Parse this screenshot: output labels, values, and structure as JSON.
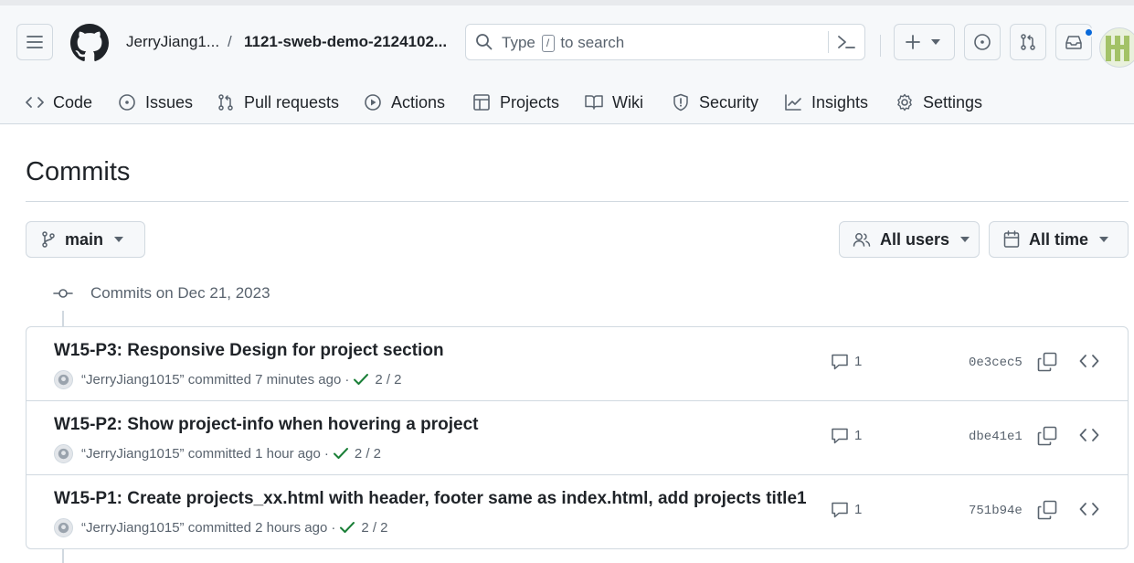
{
  "header": {
    "owner": "JerryJiang1...",
    "separator": "/",
    "repo": "1121-sweb-demo-2124102...",
    "search": {
      "before": "Type",
      "key": "/",
      "after": "to search"
    }
  },
  "nav": {
    "code": "Code",
    "issues": "Issues",
    "pull_requests": "Pull requests",
    "actions": "Actions",
    "projects": "Projects",
    "wiki": "Wiki",
    "security": "Security",
    "insights": "Insights",
    "settings": "Settings"
  },
  "page": {
    "title": "Commits",
    "branch": "main",
    "users_filter": "All users",
    "time_filter": "All time",
    "group_label": "Commits on Dec 21, 2023"
  },
  "commits": [
    {
      "title": "W15-P3: Responsive Design for project section",
      "author": "“JerryJiang1015”",
      "action": "committed",
      "time": "7 minutes ago",
      "separator": "·",
      "checks": "2 / 2",
      "comments": "1",
      "sha": "0e3cec5"
    },
    {
      "title": "W15-P2: Show project-info when hovering a project",
      "author": "“JerryJiang1015”",
      "action": "committed",
      "time": "1 hour ago",
      "separator": "·",
      "checks": "2 / 2",
      "comments": "1",
      "sha": "dbe41e1"
    },
    {
      "title": "W15-P1: Create projects_xx.html with header, footer same as index.html, add projects title1",
      "author": "“JerryJiang1015”",
      "action": "committed",
      "time": "2 hours ago",
      "separator": "·",
      "checks": "2 / 2",
      "comments": "1",
      "sha": "751b94e"
    }
  ],
  "colors": {
    "accent": "#0969da",
    "success": "#1a7f37",
    "muted_text": "#59636e",
    "border": "#d1d9e0",
    "header_bg": "#f6f8fa"
  },
  "icons": {
    "menu": "hamburger-icon",
    "logo": "github-mark-icon",
    "search": "search-icon",
    "command_palette": "terminal-icon",
    "create": "plus-icon",
    "issues": "issue-opened-icon",
    "pull_requests": "git-pull-request-icon",
    "inbox": "inbox-icon",
    "branch": "git-branch-icon",
    "users": "people-icon",
    "calendar": "calendar-icon",
    "commit": "git-commit-icon",
    "check": "check-icon",
    "comment": "comment-icon",
    "copy": "copy-icon",
    "browse": "code-icon"
  }
}
